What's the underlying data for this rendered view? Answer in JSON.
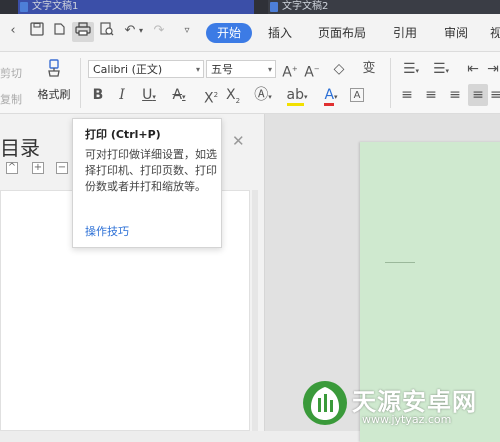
{
  "tabs": [
    {
      "label": "文字文稿1"
    },
    {
      "label": "文字文稿2"
    }
  ],
  "menu": {
    "items": [
      "开始",
      "插入",
      "页面布局",
      "引用",
      "审阅",
      "视"
    ]
  },
  "ribbon": {
    "cut_label": "剪切",
    "copy_label": "复制",
    "format_painter_label": "格式刷",
    "font_name": "Calibri (正文)",
    "font_size": "五号"
  },
  "panel": {
    "title": "目录"
  },
  "tooltip": {
    "title": "打印 (Ctrl+P)",
    "body": "可对打印做详细设置，如选择打印机、打印页数、打印份数或者并打和缩放等。",
    "link": "操作技巧"
  },
  "watermark": {
    "name": "天源安卓网",
    "url": "www.jytyaz.com"
  },
  "colors": {
    "accent": "#3c7be5",
    "page": "#cfe9cf",
    "tabbar": "#2f3138"
  }
}
